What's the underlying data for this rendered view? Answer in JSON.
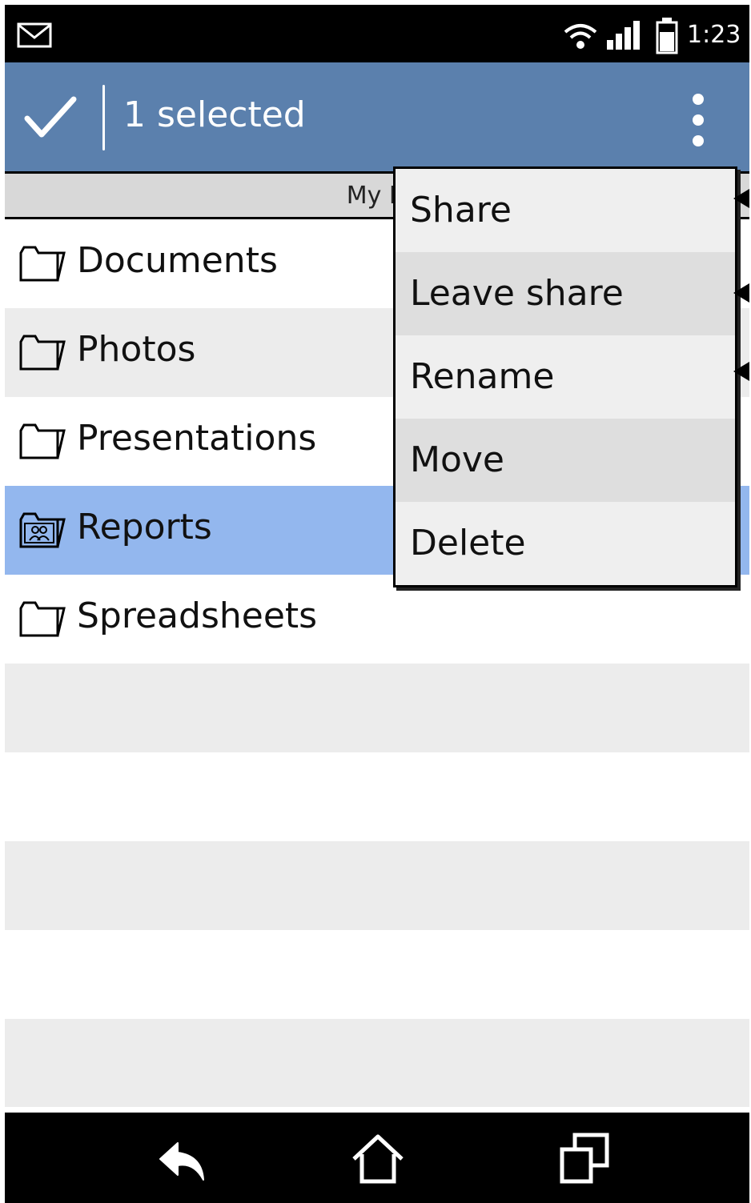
{
  "status_bar": {
    "time": "1:23"
  },
  "action_bar": {
    "title": "1 selected"
  },
  "breadcrumb": {
    "text": "My Fi"
  },
  "files": [
    {
      "name": "Documents",
      "icon": "folder-icon",
      "selected": false
    },
    {
      "name": "Photos",
      "icon": "folder-icon",
      "selected": false
    },
    {
      "name": "Presentations",
      "icon": "folder-icon",
      "selected": false
    },
    {
      "name": "Reports",
      "icon": "shared-folder-icon",
      "selected": true
    },
    {
      "name": "Spreadsheets",
      "icon": "folder-icon",
      "selected": false
    }
  ],
  "menu": {
    "items": [
      {
        "label": "Share"
      },
      {
        "label": "Leave share"
      },
      {
        "label": "Rename"
      },
      {
        "label": "Move"
      },
      {
        "label": "Delete"
      }
    ]
  },
  "colors": {
    "action_bar": "#5b80ad",
    "selected_row": "#93b7ee",
    "alt_row": "#ececec",
    "status_bar": "#000000"
  },
  "icons": {
    "status": [
      "mail-icon",
      "wifi-icon",
      "signal-icon",
      "battery-icon"
    ],
    "action": [
      "check-icon",
      "overflow-menu-icon"
    ],
    "nav": [
      "back-icon",
      "home-icon",
      "recents-icon"
    ]
  }
}
